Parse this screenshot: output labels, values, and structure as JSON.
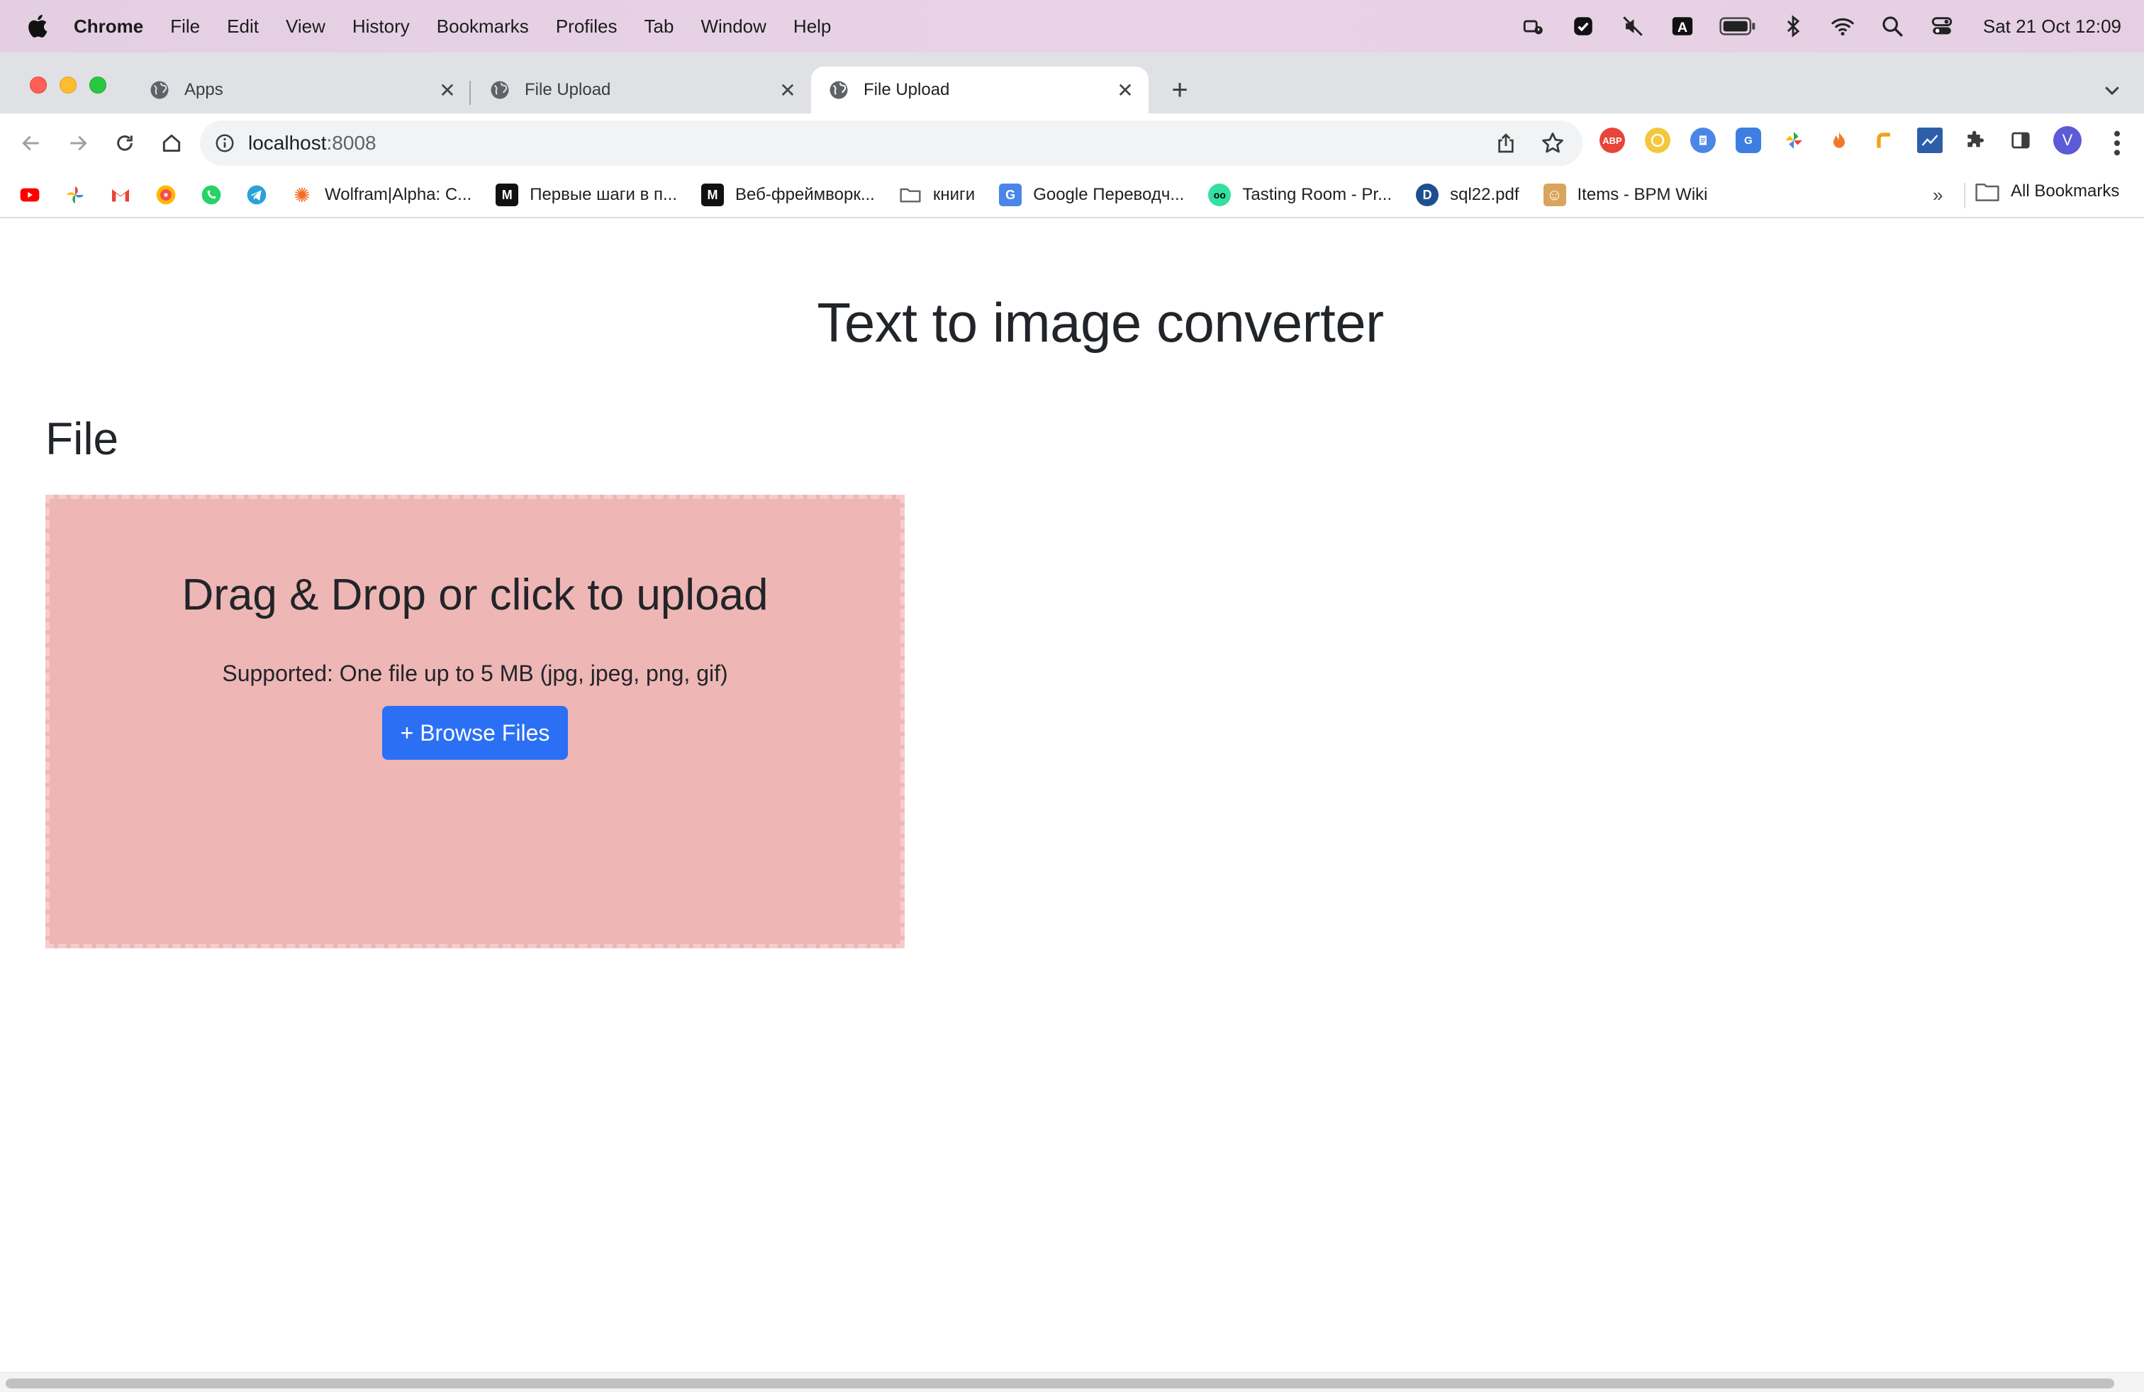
{
  "menubar": {
    "app_name": "Chrome",
    "items": [
      "File",
      "Edit",
      "View",
      "History",
      "Bookmarks",
      "Profiles",
      "Tab",
      "Window",
      "Help"
    ],
    "status_icons": [
      "stage-manager-icon",
      "checkmark-shield-icon",
      "muted-speaker-icon",
      "input-source-icon",
      "battery-icon",
      "bluetooth-icon",
      "wifi-icon",
      "spotlight-search-icon",
      "control-center-icon"
    ],
    "input_source_label": "A",
    "clock": "Sat 21 Oct  12:09"
  },
  "tabs": [
    {
      "title": "Apps",
      "active": false
    },
    {
      "title": "File Upload",
      "active": false
    },
    {
      "title": "File Upload",
      "active": true
    }
  ],
  "toolbar": {
    "url_host": "localhost",
    "url_port": ":8008",
    "extensions": [
      {
        "name": "adblock-plus-icon",
        "label": "ABP",
        "color": "#e8443a"
      },
      {
        "name": "coin-extension-icon",
        "label": "",
        "color": "#f3c83c"
      },
      {
        "name": "docs-extension-icon",
        "label": "",
        "color": "#4a86e8"
      },
      {
        "name": "google-translate-icon",
        "label": "",
        "color": "#3d7fe0"
      },
      {
        "name": "pinwheel-extension-icon",
        "label": "",
        "color": "#2fa84f"
      },
      {
        "name": "fire-extension-icon",
        "label": "",
        "color": "#f07a2a"
      },
      {
        "name": "pipe-extension-icon",
        "label": "",
        "color": "#f2a31b"
      },
      {
        "name": "chart-extension-icon",
        "label": "",
        "color": "#2c5fa8"
      }
    ],
    "profile_initial": "V"
  },
  "bookmarks": {
    "icon_only": [
      {
        "name": "youtube-bookmark-icon",
        "color": "#ff0000"
      },
      {
        "name": "google-photos-bookmark-icon",
        "color": "#fbbc05"
      },
      {
        "name": "gmail-bookmark-icon",
        "color": "#ea4335"
      },
      {
        "name": "music-bookmark-icon",
        "color": "#fc4c4c"
      },
      {
        "name": "whatsapp-bookmark-icon",
        "color": "#25d366"
      },
      {
        "name": "telegram-bookmark-icon",
        "color": "#2aa1da"
      }
    ],
    "items": [
      {
        "label": "Wolfram|Alpha: C...",
        "icon": "wolfram-icon",
        "color": "#f26d22",
        "glyph": "✺"
      },
      {
        "label": "Первые шаги в п...",
        "icon": "metanit-icon",
        "color": "#111111",
        "glyph": "M"
      },
      {
        "label": "Веб-фреймворк...",
        "icon": "metanit-icon",
        "color": "#111111",
        "glyph": "M"
      },
      {
        "label": "книги",
        "icon": "folder-icon",
        "color": "#ffffff",
        "glyph": ""
      },
      {
        "label": "Google Переводч...",
        "icon": "google-translate-icon",
        "color": "#4a86e8",
        "glyph": "G"
      },
      {
        "label": "Tasting Room - Pr...",
        "icon": "tripadvisor-icon",
        "color": "#34e0a1",
        "glyph": "oo"
      },
      {
        "label": "sql22.pdf",
        "icon": "pdf-icon",
        "color": "#1f4f8f",
        "glyph": "D"
      },
      {
        "label": "Items - BPM Wiki",
        "icon": "wiki-icon",
        "color": "#d9a45b",
        "glyph": "☺"
      }
    ],
    "more": "»",
    "all_bookmarks": "All Bookmarks"
  },
  "page": {
    "title": "Text to image converter",
    "section_title": "File",
    "dropzone": {
      "title": "Drag & Drop or click to upload",
      "subtitle": "Supported: One file up to 5 MB (jpg, jpeg, png, gif)",
      "button_label": "+ Browse Files"
    }
  },
  "colors": {
    "dropzone_bg": "#efb6b6",
    "dropzone_border": "#f5cccc",
    "button_bg": "#2b6ff5",
    "menubar_bg": "#e6d0e4",
    "tabstrip_bg": "#dfe1e5"
  }
}
